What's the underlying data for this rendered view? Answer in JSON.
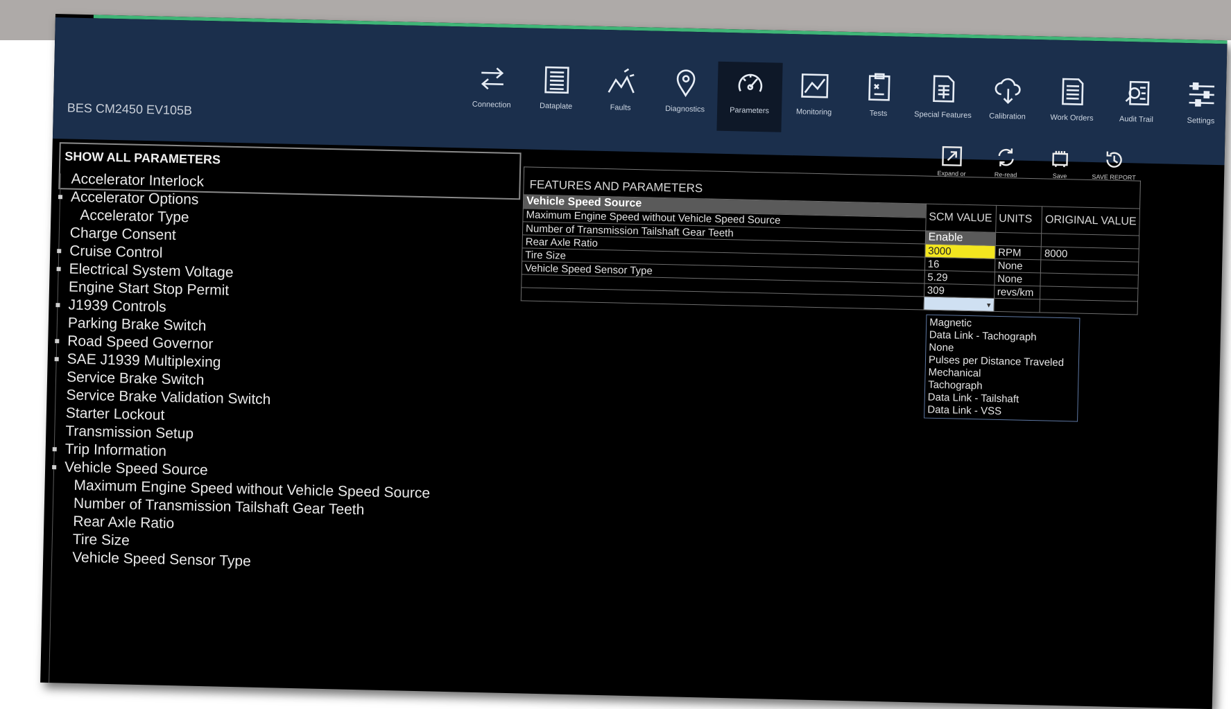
{
  "device_name": "BES CM2450 EV105B",
  "nav": [
    {
      "label": "Connection",
      "icon": "swap-arrows-icon"
    },
    {
      "label": "Dataplate",
      "icon": "list-document-icon"
    },
    {
      "label": "Faults",
      "icon": "faults-chart-icon"
    },
    {
      "label": "Diagnostics",
      "icon": "diagnostics-pin-icon"
    },
    {
      "label": "Parameters",
      "icon": "gauge-icon",
      "active": true
    },
    {
      "label": "Monitoring",
      "icon": "monitor-graph-icon"
    },
    {
      "label": "Tests",
      "icon": "clipboard-icon"
    },
    {
      "label": "Special Features",
      "icon": "special-doc-icon"
    },
    {
      "label": "Calibration",
      "icon": "cloud-download-icon"
    },
    {
      "label": "Work Orders",
      "icon": "work-order-icon"
    },
    {
      "label": "Audit Trail",
      "icon": "audit-search-icon"
    },
    {
      "label": "Settings",
      "icon": "sliders-icon"
    }
  ],
  "left_panel": {
    "title": "SHOW ALL PARAMETERS",
    "tree": [
      {
        "label": "Accelerator Interlock",
        "indent": 1
      },
      {
        "label": "Accelerator Options",
        "indent": 1,
        "expandable": true
      },
      {
        "label": "Accelerator Type",
        "indent": 2
      },
      {
        "label": "Charge Consent",
        "indent": 1
      },
      {
        "label": "Cruise Control",
        "indent": 1,
        "expandable": true
      },
      {
        "label": "Electrical System Voltage",
        "indent": 1,
        "expandable": true
      },
      {
        "label": "Engine Start Stop Permit",
        "indent": 1
      },
      {
        "label": "J1939 Controls",
        "indent": 1,
        "expandable": true
      },
      {
        "label": "Parking Brake Switch",
        "indent": 1
      },
      {
        "label": "Road Speed Governor",
        "indent": 1,
        "expandable": true
      },
      {
        "label": "SAE J1939 Multiplexing",
        "indent": 1,
        "expandable": true
      },
      {
        "label": "Service Brake Switch",
        "indent": 1
      },
      {
        "label": "Service Brake Validation Switch",
        "indent": 1
      },
      {
        "label": "Starter Lockout",
        "indent": 1
      },
      {
        "label": "Transmission Setup",
        "indent": 1
      },
      {
        "label": "Trip Information",
        "indent": 1,
        "expandable": true
      },
      {
        "label": "Vehicle Speed Source",
        "indent": 1,
        "expandable": true
      },
      {
        "label": "Maximum Engine Speed without Vehicle Speed Source",
        "indent": 2
      },
      {
        "label": "Number of Transmission Tailshaft Gear Teeth",
        "indent": 2
      },
      {
        "label": "Rear Axle Ratio",
        "indent": 2
      },
      {
        "label": "Tire Size",
        "indent": 2
      },
      {
        "label": "Vehicle Speed Sensor Type",
        "indent": 2
      }
    ]
  },
  "features": {
    "title": "FEATURES AND PARAMETERS",
    "toolbar": [
      {
        "label": "Expand or",
        "icon": "expand-icon"
      },
      {
        "label": "Re-read",
        "icon": "refresh-icon"
      },
      {
        "label": "Save",
        "icon": "save-chip-icon"
      },
      {
        "label": "SAVE REPORT",
        "icon": "report-clock-icon"
      }
    ],
    "columns": [
      "SCM VALUE",
      "UNITS",
      "ORIGINAL VALUE"
    ],
    "group": {
      "name": "Vehicle Speed Source",
      "value": "Enable"
    },
    "rows": [
      {
        "name": "Maximum Engine Speed without Vehicle Speed Source",
        "value": "3000",
        "units": "RPM",
        "original": "8000",
        "highlight": true
      },
      {
        "name": "Number of Transmission Tailshaft Gear Teeth",
        "value": "16",
        "units": "None",
        "original": ""
      },
      {
        "name": "Rear Axle Ratio",
        "value": "5.29",
        "units": "None",
        "original": ""
      },
      {
        "name": "Tire Size",
        "value": "309",
        "units": "revs/km",
        "original": ""
      },
      {
        "name": "Vehicle Speed Sensor Type",
        "value": "",
        "units": "",
        "original": "",
        "dropdown": true
      }
    ],
    "dropdown_options": [
      "Magnetic",
      "Data Link - Tachograph",
      "None",
      "Pulses per Distance Traveled",
      "Mechanical",
      "Tachograph",
      "Data Link - Tailshaft",
      "Data Link - VSS"
    ]
  }
}
